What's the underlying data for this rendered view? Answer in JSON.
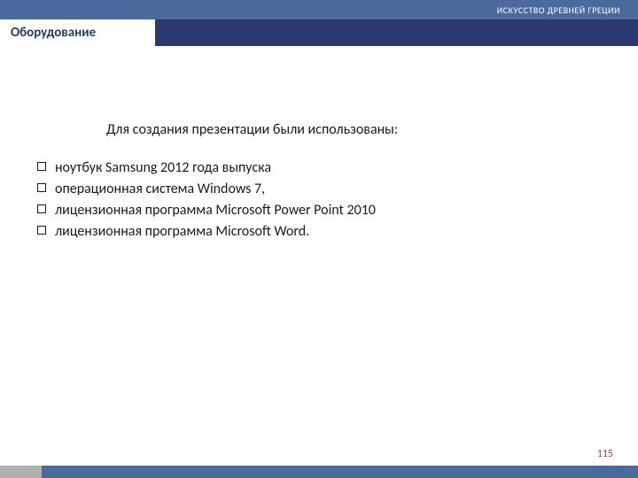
{
  "header": {
    "topTitle": "ИСКУССТВО ДРЕВНЕЙ ГРЕЦИИ",
    "sectionTitle": "Оборудование"
  },
  "content": {
    "intro": "Для создания презентации были использованы:",
    "items": [
      "ноутбук Samsung 2012 года выпуска",
      "операционная система Windows 7,",
      "лицензионная программа Microsoft Power Point 2010",
      "лицензионная программа Microsoft Word."
    ]
  },
  "pageNumber": "115"
}
